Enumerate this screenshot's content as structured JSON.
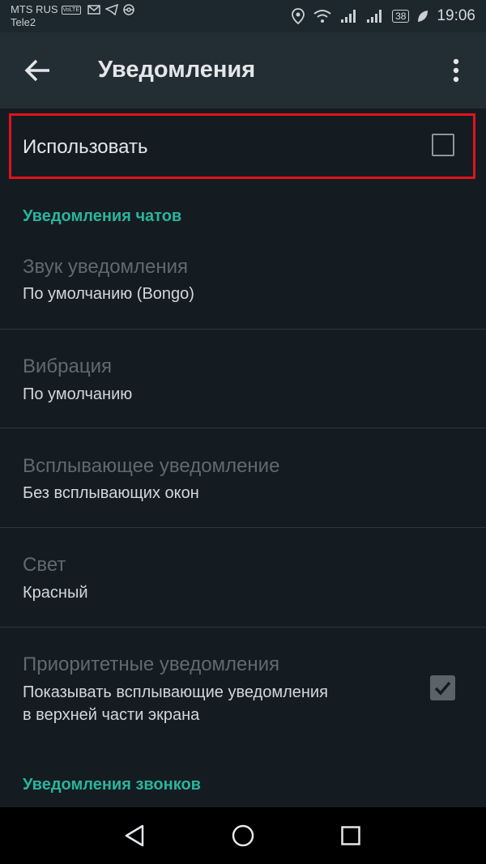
{
  "status_bar": {
    "carrier1": "MTS RUS",
    "volte": "VoLTE",
    "carrier2": "Tele2",
    "battery": "38",
    "time": "19:06"
  },
  "toolbar": {
    "title": "Уведомления"
  },
  "use_toggle": {
    "label": "Использовать",
    "checked": false
  },
  "chat_section": {
    "header": "Уведомления чатов",
    "items": [
      {
        "title": "Звук уведомления",
        "subtitle": "По умолчанию (Bongo)"
      },
      {
        "title": "Вибрация",
        "subtitle": "По умолчанию"
      },
      {
        "title": "Всплывающее уведомление",
        "subtitle": "Без всплывающих окон"
      },
      {
        "title": "Свет",
        "subtitle": "Красный"
      }
    ],
    "priority": {
      "title": "Приоритетные уведомления",
      "subtitle_line1": "Показывать всплывающие уведомления",
      "subtitle_line2": "в верхней части экрана",
      "checked": true
    }
  },
  "calls_section": {
    "header": "Уведомления звонков"
  },
  "icons": {
    "back": "arrow-back-icon",
    "menu": "more-vert-icon",
    "nav_back": "triangle-back-icon",
    "nav_home": "circle-home-icon",
    "nav_recents": "square-recents-icon"
  },
  "colors": {
    "accent": "#2bb49b",
    "highlight_border": "#e0141b",
    "background": "#141c22",
    "toolbar": "#232d34"
  }
}
